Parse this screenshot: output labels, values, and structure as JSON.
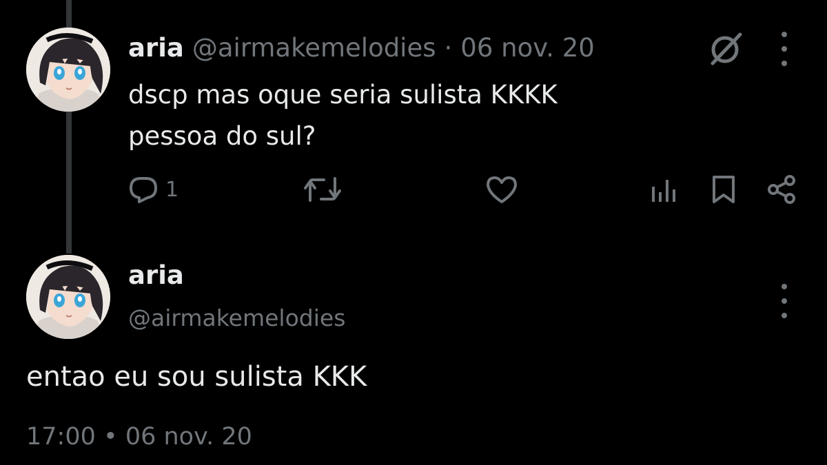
{
  "colors": {
    "background": "#000000",
    "primary_text": "#e7e9ea",
    "secondary_text": "#71767b",
    "thread_line": "#333639"
  },
  "reply_tweet": {
    "author_name": "aria",
    "author_handle": "@airmakemelodies",
    "separator": "·",
    "date": "06 nov. 20",
    "text_lines": [
      "dscp mas oque seria sulista KKKK",
      "pessoa do sul?"
    ],
    "reply_count": "1",
    "icons": {
      "grok": "grok-icon",
      "more": "more-icon",
      "reply": "reply-icon",
      "retweet": "retweet-icon",
      "like": "heart-icon",
      "views": "views-icon",
      "bookmark": "bookmark-icon",
      "share": "share-icon"
    }
  },
  "main_tweet": {
    "author_name": "aria",
    "author_handle": "@airmakemelodies",
    "text": "entao eu sou sulista KKK",
    "time": "17:00",
    "separator": "•",
    "date": "06 nov. 20",
    "icons": {
      "more": "more-icon"
    }
  }
}
